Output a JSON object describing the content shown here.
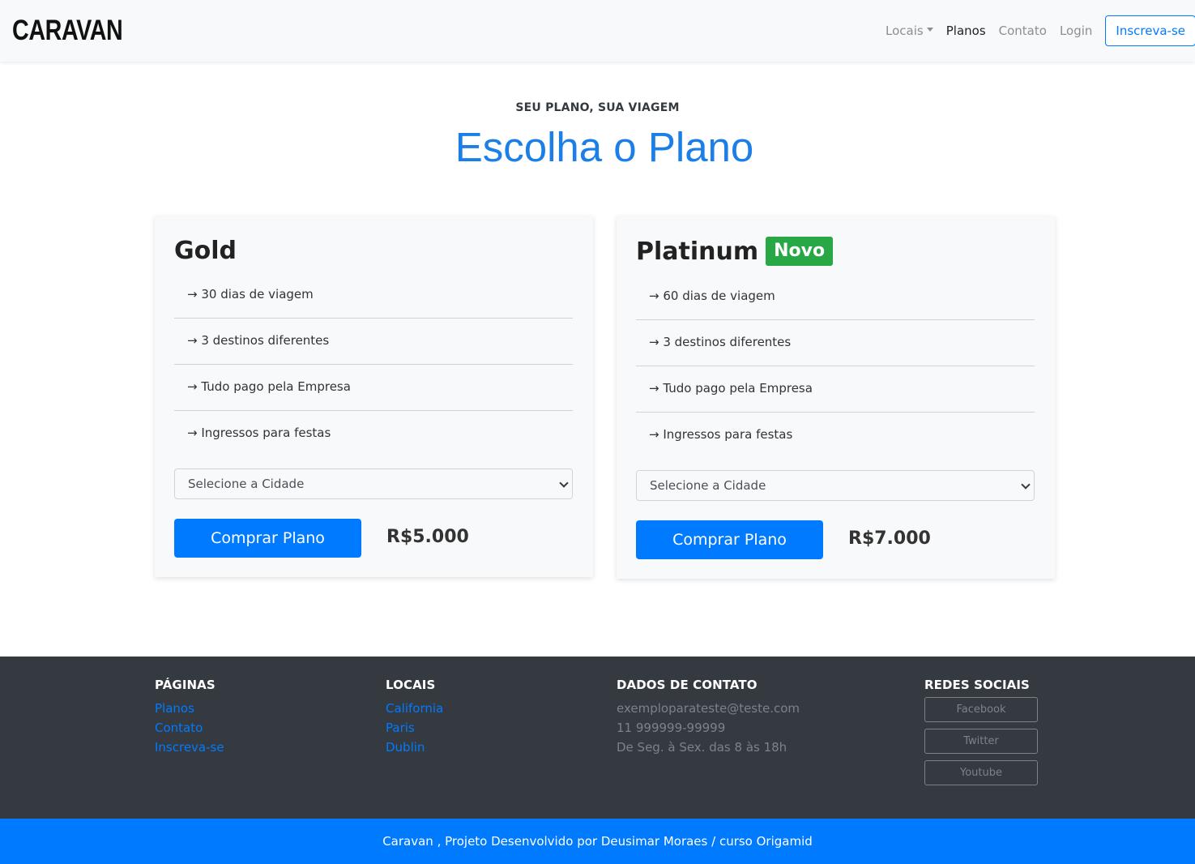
{
  "navbar": {
    "brand": "CARAVAN",
    "links": {
      "locais": "Locais",
      "planos": "Planos",
      "contato": "Contato",
      "login": "Login"
    },
    "signup": "Inscreva-se"
  },
  "header": {
    "subtitle": "SEU PLANO, SUA VIAGEM",
    "title": "Escolha o Plano"
  },
  "plans": [
    {
      "name": "Gold",
      "features": [
        "→ 30 dias de viagem",
        "→ 3 destinos diferentes",
        "→ Tudo pago pela Empresa",
        "→ Ingressos para festas"
      ],
      "select_value": "Selecione a Cidade",
      "button": "Comprar Plano",
      "price": "R$5.000"
    },
    {
      "name": "Platinum",
      "badge": "Novo",
      "features": [
        "→ 60 dias de viagem",
        "→ 3 destinos diferentes",
        "→ Tudo pago pela Empresa",
        "→ Ingressos para festas"
      ],
      "select_value": "Selecione a Cidade",
      "button": "Comprar Plano",
      "price": "R$7.000"
    }
  ],
  "footer": {
    "paginas": {
      "heading": "PÁGINAS",
      "links": [
        "Planos",
        "Contato",
        "Inscreva-se"
      ]
    },
    "locais": {
      "heading": "LOCAIS",
      "links": [
        "California",
        "Paris",
        "Dublin"
      ]
    },
    "contato": {
      "heading": "DADOS DE CONTATO",
      "lines": [
        "exemploparateste@teste.com",
        "11 999999-99999",
        "De Seg. à Sex. das 8 às 18h"
      ]
    },
    "redes": {
      "heading": "REDES SOCIAIS",
      "buttons": [
        "Facebook",
        "Twitter",
        "Youtube"
      ]
    }
  },
  "copyright": "Caravan , Projeto Desenvolvido por Deusimar Moraes / curso Origamid",
  "colors": {
    "primary": "#007bff",
    "success": "#28a745",
    "dark": "#343a40",
    "light": "#f8f9fa"
  }
}
